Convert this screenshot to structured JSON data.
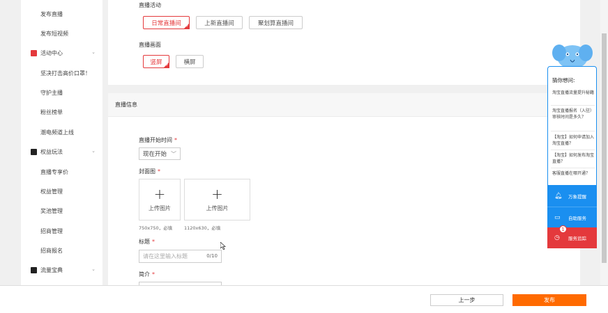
{
  "sidebar": {
    "items": [
      {
        "label": "发布直播",
        "type": "sub"
      },
      {
        "label": "发布短视频",
        "type": "sub"
      },
      {
        "label": "活动中心",
        "type": "group",
        "icon": "calendar-icon",
        "color": "#e4393c"
      },
      {
        "label": "坚决打击高价口罩！",
        "type": "sub"
      },
      {
        "label": "守护主播",
        "type": "sub"
      },
      {
        "label": "粉丝榜单",
        "type": "sub"
      },
      {
        "label": "潮电频道上线",
        "type": "sub"
      },
      {
        "label": "权益玩法",
        "type": "group",
        "icon": "gift-icon",
        "color": "#222222"
      },
      {
        "label": "直播专享价",
        "type": "sub"
      },
      {
        "label": "权益管理",
        "type": "sub"
      },
      {
        "label": "奖池管理",
        "type": "sub"
      },
      {
        "label": "招商管理",
        "type": "sub"
      },
      {
        "label": "招商报名",
        "type": "sub"
      },
      {
        "label": "流量宝典",
        "type": "group",
        "icon": "chart-icon",
        "color": "#222222"
      }
    ]
  },
  "activity": {
    "label": "直播活动",
    "options": [
      "日常直播间",
      "上新直播间",
      "聚划算直播间"
    ],
    "selected": "日常直播间"
  },
  "screen": {
    "label": "直播画面",
    "options": [
      "竖屏",
      "横屏"
    ],
    "selected": "竖屏"
  },
  "info": {
    "header": "直播信息",
    "start_time_label": "直播开始时间",
    "start_time_value": "现在开始",
    "cover_label": "封面图",
    "upload_label": "上传图片",
    "hint_square": "750x750，必填",
    "hint_wide": "1120x630，必填",
    "title_label": "标题",
    "title_placeholder": "请在这里输入标题",
    "title_count": "0/10",
    "intro_label": "简介",
    "required_mark": "*"
  },
  "footer": {
    "prev_label": "上一步",
    "publish_label": "发布"
  },
  "helper": {
    "title": "猜你想问:",
    "questions": [
      "淘宝直播流量提升秘籍",
      "淘宝直播报名（入驻）审核时间是多久？",
      "【淘宝】如何申请加入淘宝直播？",
      "【淘宝】如何发布淘宝直播？",
      "客服直播在哪开通？"
    ],
    "services": [
      {
        "label": "万象提醒",
        "icon": "bell-icon",
        "color": "#1a8ff0"
      },
      {
        "label": "自助服务",
        "icon": "chat-icon",
        "color": "#1a8ff0"
      },
      {
        "label": "服务追踪",
        "icon": "clock-icon",
        "color": "#e4393c"
      }
    ],
    "badge": "1"
  },
  "colors": {
    "accent": "#e4393c",
    "publish": "#ff6a00",
    "helper_blue": "#1a8ff0"
  }
}
